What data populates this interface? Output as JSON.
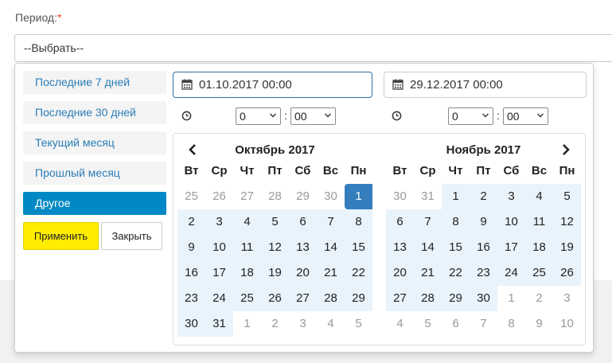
{
  "form": {
    "label": "Период:",
    "required_mark": "*",
    "select_value": "--Выбрать--"
  },
  "ranges": [
    {
      "label": "Последние 7 дней",
      "active": false
    },
    {
      "label": "Последние 30 дней",
      "active": false
    },
    {
      "label": "Текущий месяц",
      "active": false
    },
    {
      "label": "Прошлый месяц",
      "active": false
    },
    {
      "label": "Другое",
      "active": true
    }
  ],
  "buttons": {
    "apply": "Применить",
    "close": "Закрыть"
  },
  "start": {
    "date": "01.10.2017 00:00",
    "hour": "0",
    "minute": "00"
  },
  "end": {
    "date": "29.12.2017 00:00",
    "hour": "0",
    "minute": "00"
  },
  "time_separator": ":",
  "weekdays": [
    "Вт",
    "Ср",
    "Чт",
    "Пт",
    "Сб",
    "Вс",
    "Пн"
  ],
  "calendars": [
    {
      "title": "Октябрь 2017",
      "weeks": [
        [
          "25",
          "26",
          "27",
          "28",
          "29",
          "30",
          "1"
        ],
        [
          "2",
          "3",
          "4",
          "5",
          "6",
          "7",
          "8"
        ],
        [
          "9",
          "10",
          "11",
          "12",
          "13",
          "14",
          "15"
        ],
        [
          "16",
          "17",
          "18",
          "19",
          "20",
          "21",
          "22"
        ],
        [
          "23",
          "24",
          "25",
          "26",
          "27",
          "28",
          "29"
        ],
        [
          "30",
          "31",
          "1",
          "2",
          "3",
          "4",
          "5"
        ]
      ]
    },
    {
      "title": "Ноябрь 2017",
      "weeks": [
        [
          "30",
          "31",
          "1",
          "2",
          "3",
          "4",
          "5"
        ],
        [
          "6",
          "7",
          "8",
          "9",
          "10",
          "11",
          "12"
        ],
        [
          "13",
          "14",
          "15",
          "16",
          "17",
          "18",
          "19"
        ],
        [
          "20",
          "21",
          "22",
          "23",
          "24",
          "25",
          "26"
        ],
        [
          "27",
          "28",
          "29",
          "30",
          "1",
          "2",
          "3"
        ],
        [
          "4",
          "5",
          "6",
          "7",
          "8",
          "9",
          "10"
        ]
      ]
    }
  ],
  "colors": {
    "accent": "#0089c4",
    "apply": "#ffec00",
    "selected": "#357ebd",
    "range": "#e9f3fb"
  },
  "icons": {
    "calendar": "calendar-icon",
    "clock": "clock-icon",
    "prev": "chevron-left-icon",
    "next": "chevron-right-icon"
  }
}
